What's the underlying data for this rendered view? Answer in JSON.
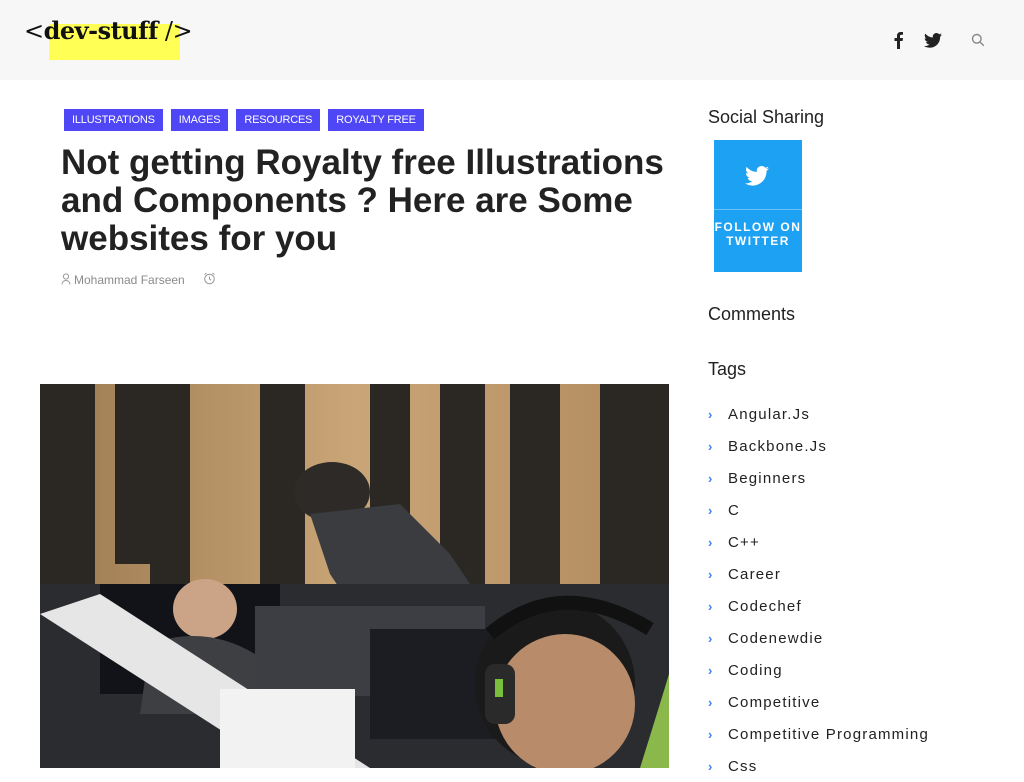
{
  "header": {
    "logo_prefix": "<",
    "logo_name": "dev-stuff",
    "logo_suffix": " />",
    "icons": [
      "facebook-icon",
      "twitter-icon",
      "search-icon"
    ]
  },
  "post": {
    "categories": [
      "ILLUSTRATIONS",
      "IMAGES",
      "RESOURCES",
      "ROYALTY FREE"
    ],
    "title": "Not getting Royalty free Illustrations and Components ? Here are Some websites for you",
    "author": "Mohammad Farseen"
  },
  "sidebar": {
    "social_heading": "Social Sharing",
    "twitter_follow": "FOLLOW ON TWITTER",
    "comments_heading": "Comments",
    "tags_heading": "Tags",
    "tags": [
      "Angular.Js",
      "Backbone.Js",
      "Beginners",
      "C",
      "C++",
      "Career",
      "Codechef",
      "Codenewdie",
      "Coding",
      "Competitive",
      "Competitive Programming",
      "Css"
    ]
  },
  "colors": {
    "category_bg": "#4f46f5",
    "twitter_blue": "#1da1f2",
    "logo_highlight": "#ffff55"
  }
}
